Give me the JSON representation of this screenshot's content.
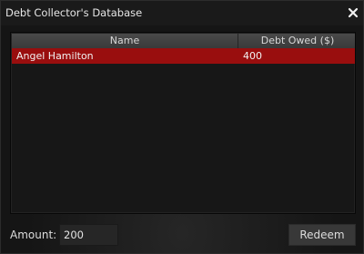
{
  "window": {
    "title": "Debt Collector's Database"
  },
  "table": {
    "columns": [
      "Name",
      "Debt Owed ($)"
    ],
    "rows": [
      {
        "name": "Angel Hamilton",
        "debt": "400",
        "selected": true
      }
    ]
  },
  "footer": {
    "amount_label": "Amount:",
    "amount_value": "200",
    "redeem_label": "Redeem"
  },
  "colors": {
    "selected_row": "#990e0e",
    "background": "#151515"
  },
  "icons": {
    "close": "close-icon"
  }
}
